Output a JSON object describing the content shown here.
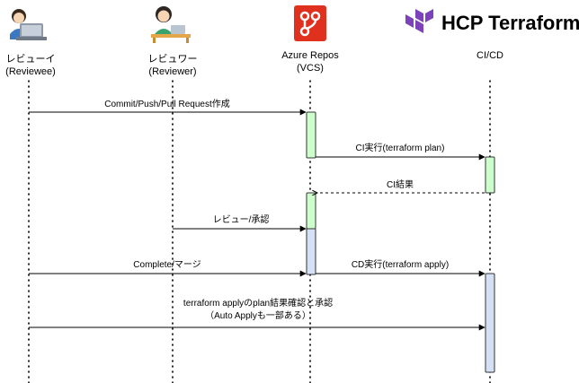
{
  "participants": [
    {
      "id": "reviewee",
      "name_line1": "レビューイ",
      "name_line2": "(Reviewee)",
      "icon": "person-at-laptop-icon"
    },
    {
      "id": "reviewer",
      "name_line1": "レビュワー",
      "name_line2": "(Reviewer)",
      "icon": "person-at-desk-icon"
    },
    {
      "id": "vcs",
      "name_line1": "Azure Repos",
      "name_line2": "(VCS)",
      "icon": "azure-repos-icon"
    },
    {
      "id": "cicd",
      "name_line1": "CI/CD",
      "name_line2": "",
      "icon": "hcp-terraform-logo"
    }
  ],
  "brand": {
    "text": "HCP Terraform",
    "logo_color": "#7B42BC"
  },
  "messages": [
    {
      "label": "Commit/Push/Pull Request作成",
      "from": "reviewee",
      "to": "vcs",
      "style": "solid"
    },
    {
      "label": "CI実行(terraform plan)",
      "from": "vcs",
      "to": "cicd",
      "style": "solid"
    },
    {
      "label": "CI結果",
      "from": "cicd",
      "to": "vcs",
      "style": "dashed"
    },
    {
      "label": "レビュー/承認",
      "from": "reviewer",
      "to": "vcs",
      "style": "solid"
    },
    {
      "label": "Complete/マージ",
      "from": "reviewee",
      "to": "vcs",
      "style": "solid"
    },
    {
      "label": "CD実行(terraform apply)",
      "from": "vcs",
      "to": "cicd",
      "style": "solid"
    },
    {
      "label_line1": "terraform applyのplan結果確認と承認",
      "label_line2": "（Auto Applyも一部ある）",
      "from": "reviewee",
      "to": "cicd",
      "style": "solid"
    }
  ],
  "colors": {
    "activation_green": "#CCFFCC",
    "activation_blue": "#D4E1F5",
    "activation_border": "#333333",
    "azure_red": "#E0301E",
    "terraform_purple": "#7B42BC",
    "line": "#000000"
  }
}
